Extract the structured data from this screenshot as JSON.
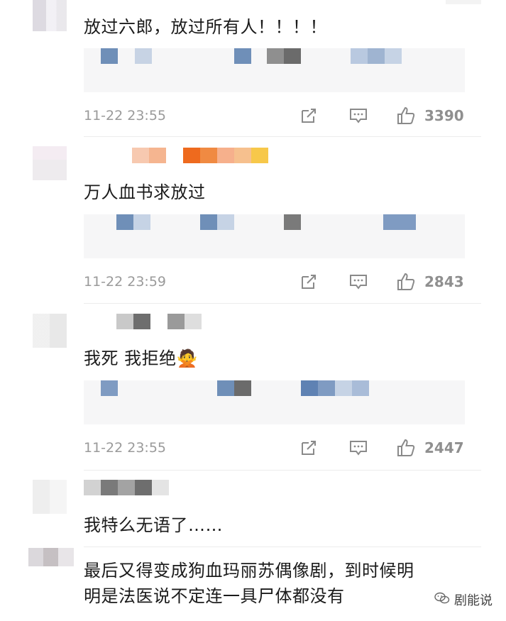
{
  "comments": [
    {
      "text": "放过六郎，放过所有人！！！！",
      "time": "11-22 23:55",
      "likes": "3390"
    },
    {
      "text": "万人血书求放过",
      "time": "11-22 23:59",
      "likes": "2843"
    },
    {
      "text": "我死  我拒绝🙅",
      "time": "11-22 23:55",
      "likes": "2447"
    },
    {
      "text": "我特么无语了……"
    },
    {
      "text_line1": "最后又得变成狗血玛丽苏偶像剧，到时候明",
      "text_line2": "明是法医说不定连一具尸体都没有"
    }
  ],
  "icons": {
    "share": "share-icon",
    "reply": "comment-icon",
    "like": "thumbs-up-icon"
  },
  "watermark": {
    "label": "剧能说",
    "icon": "wechat-icon"
  },
  "colors": {
    "time": "#9a9a9a",
    "likes": "#8f8f8f",
    "text": "#1b1b1b"
  }
}
